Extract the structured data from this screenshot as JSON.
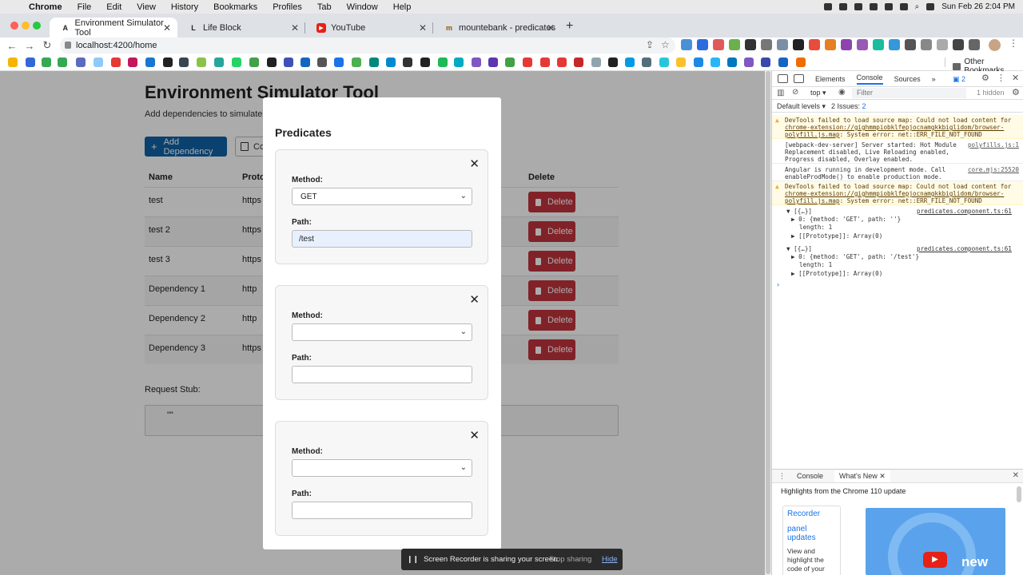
{
  "macos_menu": {
    "app": "Chrome",
    "items": [
      "File",
      "Edit",
      "View",
      "History",
      "Bookmarks",
      "Profiles",
      "Tab",
      "Window",
      "Help"
    ],
    "datetime": "Sun Feb 26  2:04 PM"
  },
  "tabs": [
    {
      "title": "Environment Simulator Tool",
      "favicon": "A"
    },
    {
      "title": "Life Block",
      "favicon": "L"
    },
    {
      "title": "YouTube",
      "favicon": "▶"
    },
    {
      "title": "mountebank - predicates",
      "favicon": "m"
    }
  ],
  "address": {
    "url": "localhost:4200/home"
  },
  "bookmarks": {
    "other": "Other Bookmarks"
  },
  "page": {
    "title": "Environment Simulator Tool",
    "subtitle": "Add dependencies to simulate requ",
    "add_button": "Add Dependency",
    "copy_button": "Co",
    "table": {
      "headers": {
        "name": "Name",
        "protocol": "Proto",
        "delete": "Delete"
      },
      "rows": [
        {
          "name": "test",
          "protocol": "https",
          "action": "Delete"
        },
        {
          "name": "test 2",
          "protocol": "https",
          "action": "Delete"
        },
        {
          "name": "test 3",
          "protocol": "https",
          "action": "Delete"
        },
        {
          "name": "Dependency 1",
          "protocol": "http",
          "action": "Delete"
        },
        {
          "name": "Dependency 2",
          "protocol": "http",
          "action": "Delete"
        },
        {
          "name": "Dependency 3",
          "protocol": "https",
          "action": "Delete"
        }
      ]
    },
    "request_stub_label": "Request Stub:",
    "request_stub_value": "\"\""
  },
  "modal": {
    "title": "Predicates",
    "method_label": "Method:",
    "path_label": "Path:",
    "cards": [
      {
        "method": "GET",
        "path": "/test"
      },
      {
        "method": "",
        "path": ""
      },
      {
        "method": "",
        "path": ""
      }
    ]
  },
  "recorder": {
    "message": "Screen Recorder is sharing your screen.",
    "stop": "Stop sharing",
    "hide": "Hide"
  },
  "devtools": {
    "tabs": [
      "Elements",
      "Console",
      "Sources"
    ],
    "issues_badge": "2",
    "context": "top",
    "filter_placeholder": "Filter",
    "hidden": "1 hidden",
    "levels": "Default levels",
    "issues": "2 Issues:",
    "issues_count": "2",
    "messages": [
      {
        "text": "DevTools failed to load source map: Could not load content for ",
        "link": "chrome-extension://gighmmpiobklfepjocnamgkkbiglidom/browser-polyfill.js.map",
        "tail": ": System error: net::ERR_FILE_NOT_FOUND"
      },
      {
        "text": "[webpack-dev-server] Server started: Hot Module Replacement disabled, Live Reloading enabled, Progress disabled, Overlay enabled.",
        "src": "polyfills.js:1"
      },
      {
        "text": "Angular is running in development mode. Call enableProdMode() to enable production mode.",
        "src": "core.mjs:25520"
      },
      {
        "text": "DevTools failed to load source map: Could not load content for ",
        "link": "chrome-extension://gighmmpiobklfepjocnamgkkbiglidom/browser-polyfill.js.map",
        "tail": ": System error: net::ERR_FILE_NOT_FOUND"
      }
    ],
    "log1": {
      "head": "▼ [{…}]",
      "src": "predicates.component.ts:61",
      "item": "▶ 0: {method: 'GET', path: ''}",
      "length": "length: 1",
      "proto": "▶ [[Prototype]]: Array(0)"
    },
    "log2": {
      "head": "▼ [{…}]",
      "src": "predicates.component.ts:61",
      "item": "▶ 0: {method: 'GET', path: '/test'}",
      "length": "length: 1",
      "proto": "▶ [[Prototype]]: Array(0)"
    },
    "drawer": {
      "tabs": [
        "Console",
        "What's New"
      ],
      "highlights": "Highlights from the Chrome 110 update",
      "card_title": "Recorder",
      "card_sub": "panel updates",
      "card_body": "View and highlight the code of your user flow instantly, and",
      "video_text": "new"
    }
  }
}
